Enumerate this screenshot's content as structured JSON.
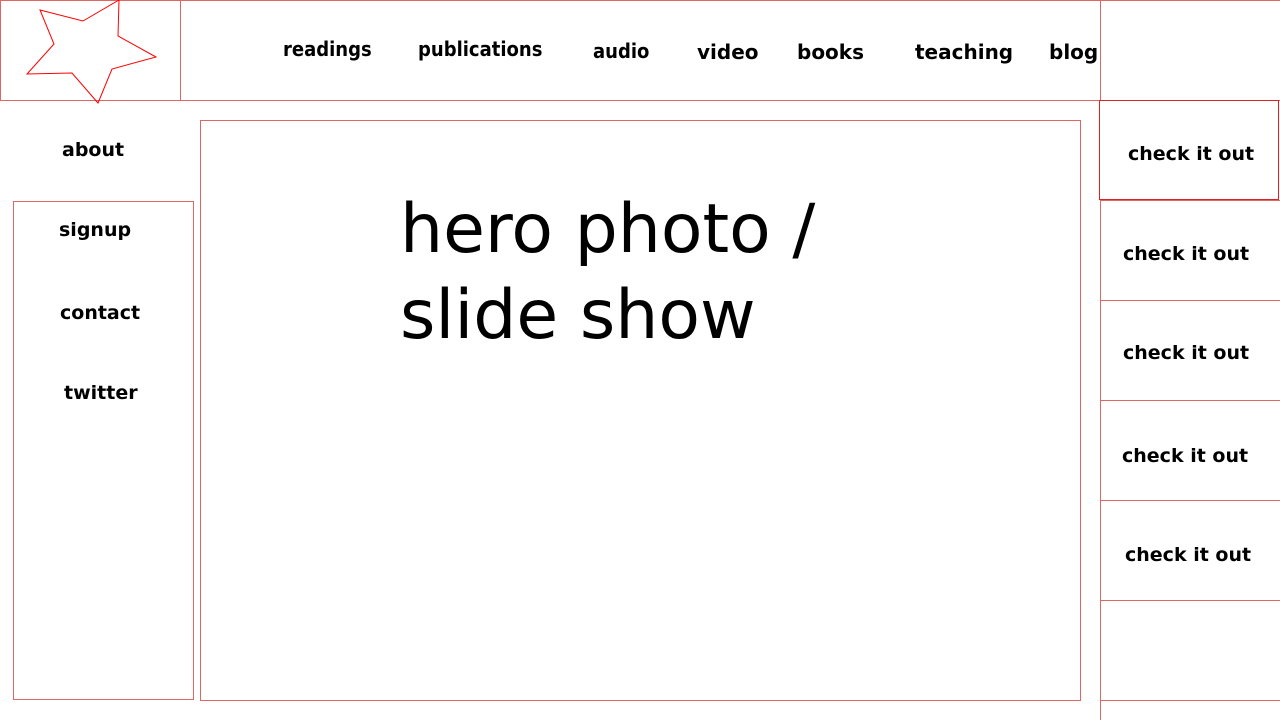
{
  "header": {
    "logo_icon": "star-icon",
    "nav": [
      {
        "label": "readings"
      },
      {
        "label": "publications"
      },
      {
        "label": "audio"
      },
      {
        "label": "video"
      },
      {
        "label": "books"
      },
      {
        "label": "teaching"
      },
      {
        "label": "blog"
      }
    ]
  },
  "sidebar": {
    "about": "about",
    "links": [
      {
        "label": "signup"
      },
      {
        "label": "contact"
      },
      {
        "label": "twitter"
      }
    ]
  },
  "hero": {
    "line1": "hero photo /",
    "line2": "slide show"
  },
  "right_panel": {
    "cta": [
      {
        "label": "check it out"
      },
      {
        "label": "check it out"
      },
      {
        "label": "check it out"
      },
      {
        "label": "check it out"
      },
      {
        "label": "check it out"
      }
    ]
  },
  "colors": {
    "wireframe_line": "#e06666",
    "logo_stroke": "#ff0000",
    "text": "#000000",
    "background": "#ffffff"
  }
}
